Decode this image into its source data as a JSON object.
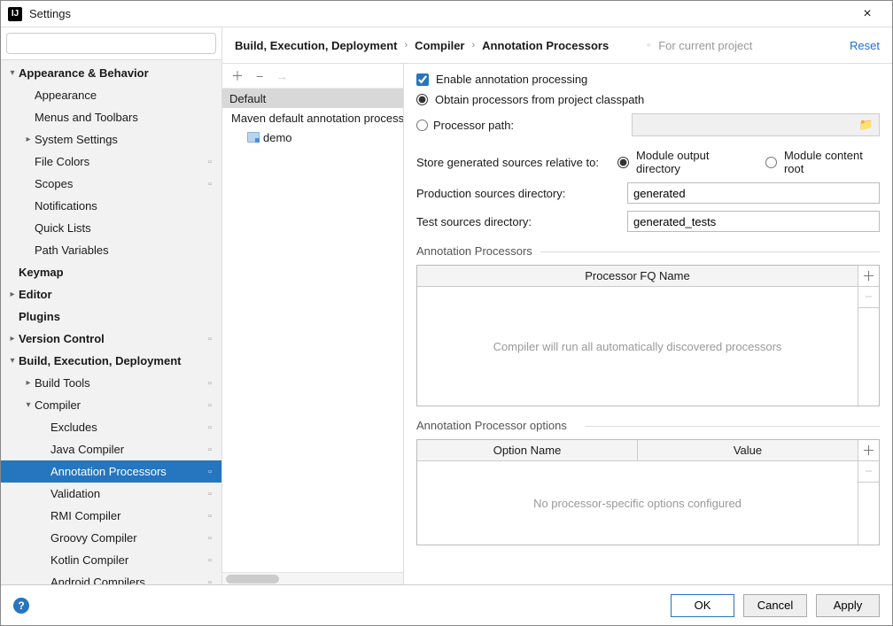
{
  "window": {
    "title": "Settings"
  },
  "search": {
    "placeholder": ""
  },
  "sidebar": {
    "items": [
      {
        "label": "Appearance & Behavior",
        "bold": true,
        "arrow": "down",
        "indent": 0,
        "mod": false
      },
      {
        "label": "Appearance",
        "bold": false,
        "arrow": "",
        "indent": 1,
        "mod": false
      },
      {
        "label": "Menus and Toolbars",
        "bold": false,
        "arrow": "",
        "indent": 1,
        "mod": false
      },
      {
        "label": "System Settings",
        "bold": false,
        "arrow": "right",
        "indent": 1,
        "mod": false
      },
      {
        "label": "File Colors",
        "bold": false,
        "arrow": "",
        "indent": 1,
        "mod": true
      },
      {
        "label": "Scopes",
        "bold": false,
        "arrow": "",
        "indent": 1,
        "mod": true
      },
      {
        "label": "Notifications",
        "bold": false,
        "arrow": "",
        "indent": 1,
        "mod": false
      },
      {
        "label": "Quick Lists",
        "bold": false,
        "arrow": "",
        "indent": 1,
        "mod": false
      },
      {
        "label": "Path Variables",
        "bold": false,
        "arrow": "",
        "indent": 1,
        "mod": false
      },
      {
        "label": "Keymap",
        "bold": true,
        "arrow": "",
        "indent": 0,
        "mod": false
      },
      {
        "label": "Editor",
        "bold": true,
        "arrow": "right",
        "indent": 0,
        "mod": false
      },
      {
        "label": "Plugins",
        "bold": true,
        "arrow": "",
        "indent": 0,
        "mod": false
      },
      {
        "label": "Version Control",
        "bold": true,
        "arrow": "right",
        "indent": 0,
        "mod": true
      },
      {
        "label": "Build, Execution, Deployment",
        "bold": true,
        "arrow": "down",
        "indent": 0,
        "mod": false
      },
      {
        "label": "Build Tools",
        "bold": false,
        "arrow": "right",
        "indent": 1,
        "mod": true
      },
      {
        "label": "Compiler",
        "bold": false,
        "arrow": "down",
        "indent": 1,
        "mod": true
      },
      {
        "label": "Excludes",
        "bold": false,
        "arrow": "",
        "indent": 2,
        "mod": true
      },
      {
        "label": "Java Compiler",
        "bold": false,
        "arrow": "",
        "indent": 2,
        "mod": true
      },
      {
        "label": "Annotation Processors",
        "bold": false,
        "arrow": "",
        "indent": 2,
        "mod": true,
        "sel": true
      },
      {
        "label": "Validation",
        "bold": false,
        "arrow": "",
        "indent": 2,
        "mod": true
      },
      {
        "label": "RMI Compiler",
        "bold": false,
        "arrow": "",
        "indent": 2,
        "mod": true
      },
      {
        "label": "Groovy Compiler",
        "bold": false,
        "arrow": "",
        "indent": 2,
        "mod": true
      },
      {
        "label": "Kotlin Compiler",
        "bold": false,
        "arrow": "",
        "indent": 2,
        "mod": true
      },
      {
        "label": "Android Compilers",
        "bold": false,
        "arrow": "",
        "indent": 2,
        "mod": true
      }
    ]
  },
  "breadcrumb": [
    "Build, Execution, Deployment",
    "Compiler",
    "Annotation Processors"
  ],
  "for_project": "For current project",
  "reset": "Reset",
  "profiles": {
    "items": [
      "Default",
      "Maven default annotation processors profile"
    ],
    "leaf": "demo",
    "selected": 0
  },
  "detail": {
    "enable_label": "Enable annotation processing",
    "enable_checked": true,
    "obtain_label": "Obtain processors from project classpath",
    "path_label": "Processor path:",
    "source_group": "obtain",
    "store_label": "Store generated sources relative to:",
    "store_opt1": "Module output directory",
    "store_opt2": "Module content root",
    "store_selected": "output",
    "prod_label": "Production sources directory:",
    "prod_value": "generated",
    "test_label": "Test sources directory:",
    "test_value": "generated_tests",
    "proc_group": "Annotation Processors",
    "proc_header": "Processor FQ Name",
    "proc_empty": "Compiler will run all automatically discovered processors",
    "opt_group": "Annotation Processor options",
    "opt_header1": "Option Name",
    "opt_header2": "Value",
    "opt_empty": "No processor-specific options configured"
  },
  "footer": {
    "ok": "OK",
    "cancel": "Cancel",
    "apply": "Apply"
  }
}
